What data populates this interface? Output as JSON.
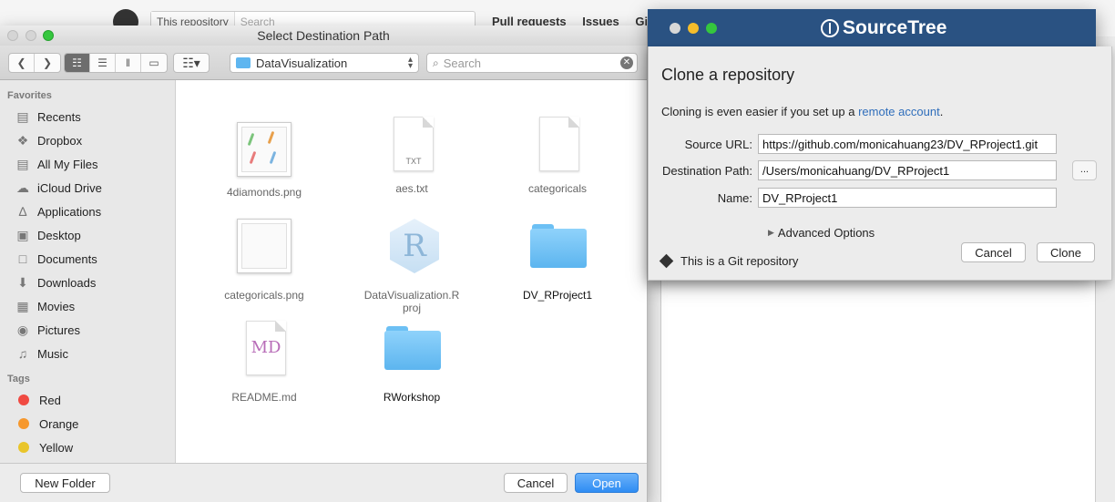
{
  "background": {
    "search_scope": "This repository",
    "search_placeholder": "Search",
    "nav": [
      "Pull requests",
      "Issues",
      "Gist"
    ]
  },
  "finder": {
    "title": "Select Destination Path",
    "location": "DataVisualization",
    "search_placeholder": "Search",
    "sidebar": {
      "favorites_heading": "Favorites",
      "favorites": [
        {
          "label": "Recents",
          "icon": "recents-icon"
        },
        {
          "label": "Dropbox",
          "icon": "dropbox-icon"
        },
        {
          "label": "All My Files",
          "icon": "all-files-icon"
        },
        {
          "label": "iCloud Drive",
          "icon": "cloud-icon"
        },
        {
          "label": "Applications",
          "icon": "applications-icon"
        },
        {
          "label": "Desktop",
          "icon": "desktop-icon"
        },
        {
          "label": "Documents",
          "icon": "documents-icon"
        },
        {
          "label": "Downloads",
          "icon": "downloads-icon"
        },
        {
          "label": "Movies",
          "icon": "movies-icon"
        },
        {
          "label": "Pictures",
          "icon": "pictures-icon"
        },
        {
          "label": "Music",
          "icon": "music-icon"
        }
      ],
      "tags_heading": "Tags",
      "tags": [
        {
          "label": "Red",
          "color": "#f04a42"
        },
        {
          "label": "Orange",
          "color": "#f6982d"
        },
        {
          "label": "Yellow",
          "color": "#e9c52a"
        }
      ]
    },
    "files": [
      {
        "name": "4diamonds.png",
        "kind": "image"
      },
      {
        "name": "aes.txt",
        "kind": "txt",
        "ext": "TXT"
      },
      {
        "name": "categoricals",
        "kind": "blank"
      },
      {
        "name": "categoricals.png",
        "kind": "image-blank"
      },
      {
        "name": "DataVisualization.R",
        "name2": "proj",
        "kind": "rproj",
        "glyph": "R"
      },
      {
        "name": "DV_RProject1",
        "kind": "folder"
      },
      {
        "name": "README.md",
        "kind": "md",
        "glyph": "MD"
      },
      {
        "name": "RWorkshop",
        "kind": "folder"
      }
    ],
    "new_folder": "New Folder",
    "cancel": "Cancel",
    "open": "Open"
  },
  "sourcetree": {
    "brand": "SourceTree",
    "heading": "Clone a repository",
    "intro_prefix": "Cloning is even easier if you set up a ",
    "intro_link": "remote account",
    "intro_suffix": ".",
    "source_url_label": "Source URL:",
    "source_url": "https://github.com/monicahuang23/DV_RProject1.git",
    "destination_label": "Destination Path:",
    "destination": "/Users/monicahuang/DV_RProject1",
    "browse": "...",
    "name_label": "Name:",
    "name": "DV_RProject1",
    "advanced": "Advanced Options",
    "git_note": "This is a Git repository",
    "cancel": "Cancel",
    "clone": "Clone"
  }
}
